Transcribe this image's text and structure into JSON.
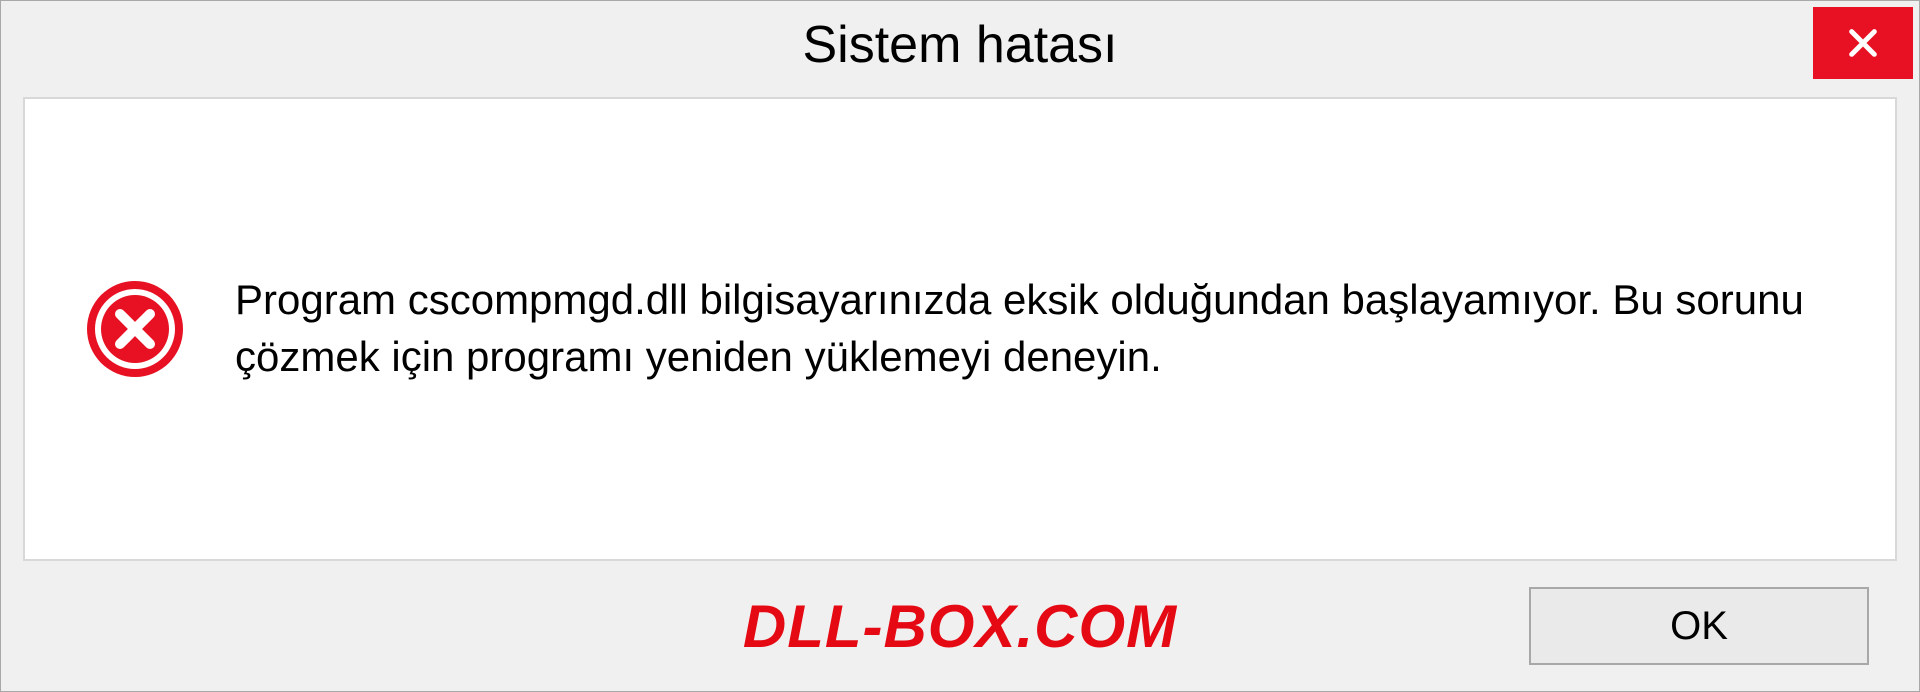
{
  "dialog": {
    "title": "Sistem hatası",
    "message": "Program cscompmgd.dll bilgisayarınızda eksik olduğundan başlayamıyor. Bu sorunu çözmek için programı yeniden yüklemeyi deneyin.",
    "ok_label": "OK"
  },
  "watermark": "DLL-BOX.COM",
  "colors": {
    "close_button": "#e81123",
    "error_icon": "#e81123",
    "watermark": "#e50914"
  }
}
